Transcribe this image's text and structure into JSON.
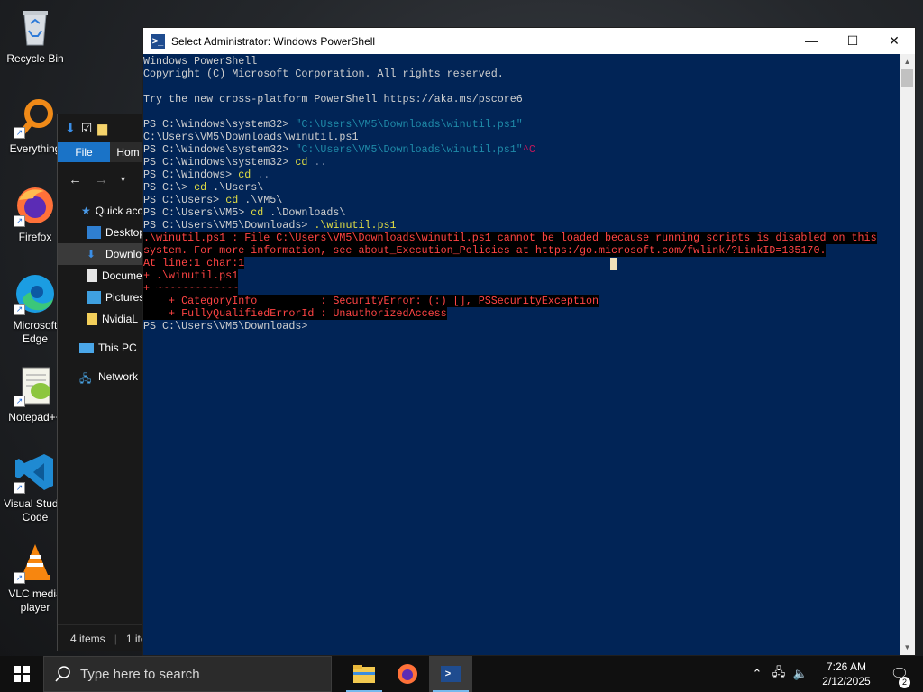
{
  "desktop": {
    "icons": [
      {
        "label": "Recycle Bin",
        "icon": "recycle-bin-icon"
      },
      {
        "label": "Everything",
        "icon": "everything-icon"
      },
      {
        "label": "Firefox",
        "icon": "firefox-icon"
      },
      {
        "label": "Microsoft Edge",
        "icon": "edge-icon"
      },
      {
        "label": "Notepad++",
        "icon": "notepad-plus-plus-icon"
      },
      {
        "label": "Visual Studio Code",
        "icon": "vscode-icon"
      },
      {
        "label": "VLC media player",
        "icon": "vlc-icon"
      }
    ]
  },
  "explorer": {
    "tabs": {
      "file": "File",
      "home": "Hom"
    },
    "tree": [
      {
        "label": "Quick acce",
        "icon": "star-icon"
      },
      {
        "label": "Desktop",
        "icon": "desktop-folder-icon"
      },
      {
        "label": "Downlo",
        "icon": "download-icon"
      },
      {
        "label": "Docume",
        "icon": "documents-icon"
      },
      {
        "label": "Pictures",
        "icon": "pictures-icon"
      },
      {
        "label": "NvidiaL",
        "icon": "folder-icon"
      },
      {
        "label": "This PC",
        "icon": "computer-icon"
      },
      {
        "label": "Network",
        "icon": "network-icon"
      }
    ],
    "status_items": "4 items",
    "status_selected": "1 ite"
  },
  "powershell": {
    "title": "Select Administrator: Windows PowerShell",
    "lines": [
      [
        {
          "t": "Windows PowerShell",
          "c": "norm"
        }
      ],
      [
        {
          "t": "Copyright (C) Microsoft Corporation. All rights reserved.",
          "c": "norm"
        }
      ],
      [
        {
          "t": "",
          "c": "norm"
        }
      ],
      [
        {
          "t": "Try the new cross-platform PowerShell https://aka.ms/pscore6",
          "c": "norm"
        }
      ],
      [
        {
          "t": "",
          "c": "norm"
        }
      ],
      [
        {
          "t": "PS C:\\Windows\\system32> ",
          "c": "norm"
        },
        {
          "t": "\"C:\\Users\\VM5\\Downloads\\winutil.ps1\"",
          "c": "str"
        }
      ],
      [
        {
          "t": "C:\\Users\\VM5\\Downloads\\winutil.ps1",
          "c": "norm"
        }
      ],
      [
        {
          "t": "PS C:\\Windows\\system32> ",
          "c": "norm"
        },
        {
          "t": "\"C:\\Users\\VM5\\Downloads\\winutil.ps1\"",
          "c": "str"
        },
        {
          "t": "^C",
          "c": "ctrl"
        }
      ],
      [
        {
          "t": "PS C:\\Windows\\system32> ",
          "c": "norm"
        },
        {
          "t": "cd",
          "c": "cmd"
        },
        {
          "t": " ..",
          "c": "op"
        }
      ],
      [
        {
          "t": "PS C:\\Windows> ",
          "c": "norm"
        },
        {
          "t": "cd",
          "c": "cmd"
        },
        {
          "t": " ..",
          "c": "op"
        }
      ],
      [
        {
          "t": "PS C:\\> ",
          "c": "norm"
        },
        {
          "t": "cd",
          "c": "cmd"
        },
        {
          "t": " .\\Users\\",
          "c": "norm"
        }
      ],
      [
        {
          "t": "PS C:\\Users> ",
          "c": "norm"
        },
        {
          "t": "cd",
          "c": "cmd"
        },
        {
          "t": " .\\VM5\\",
          "c": "norm"
        }
      ],
      [
        {
          "t": "PS C:\\Users\\VM5> ",
          "c": "norm"
        },
        {
          "t": "cd",
          "c": "cmd"
        },
        {
          "t": " .\\Downloads\\",
          "c": "norm"
        }
      ],
      [
        {
          "t": "PS C:\\Users\\VM5\\Downloads> ",
          "c": "norm"
        },
        {
          "t": ".\\winutil.ps1",
          "c": "cmd"
        }
      ],
      [
        {
          "t": ".\\winutil.ps1 : File C:\\Users\\VM5\\Downloads\\winutil.ps1 cannot be loaded because running scripts is disabled on this",
          "c": "err"
        }
      ],
      [
        {
          "t": "system. For more information, see about_Execution_Policies at https:/go.microsoft.com/fwlink/?LinkID=135170.",
          "c": "err"
        }
      ],
      [
        {
          "t": "At line:1 char:1",
          "c": "err"
        }
      ],
      [
        {
          "t": "+ .\\winutil.ps1",
          "c": "err"
        }
      ],
      [
        {
          "t": "+ ~~~~~~~~~~~~~",
          "c": "err"
        }
      ],
      [
        {
          "t": "    + CategoryInfo          : SecurityError: (:) [], PSSecurityException",
          "c": "err"
        }
      ],
      [
        {
          "t": "    + FullyQualifiedErrorId : UnauthorizedAccess",
          "c": "err"
        }
      ],
      [
        {
          "t": "PS C:\\Users\\VM5\\Downloads>",
          "c": "norm"
        }
      ]
    ]
  },
  "taskbar": {
    "search_placeholder": "Type here to search",
    "apps": [
      {
        "name": "file-explorer",
        "icon": "folder-icon"
      },
      {
        "name": "firefox",
        "icon": "firefox-icon"
      },
      {
        "name": "powershell",
        "icon": "powershell-icon"
      }
    ],
    "time": "7:26 AM",
    "date": "2/12/2025",
    "notification_count": "2"
  },
  "colors": {
    "ps_background": "#012456",
    "ps_text": "#cfcfcf",
    "ps_command": "#e0dd44",
    "ps_string": "#1f8aa8",
    "ps_error": "#ff4444",
    "taskbar": "#101010",
    "accent": "#1a73c7"
  }
}
